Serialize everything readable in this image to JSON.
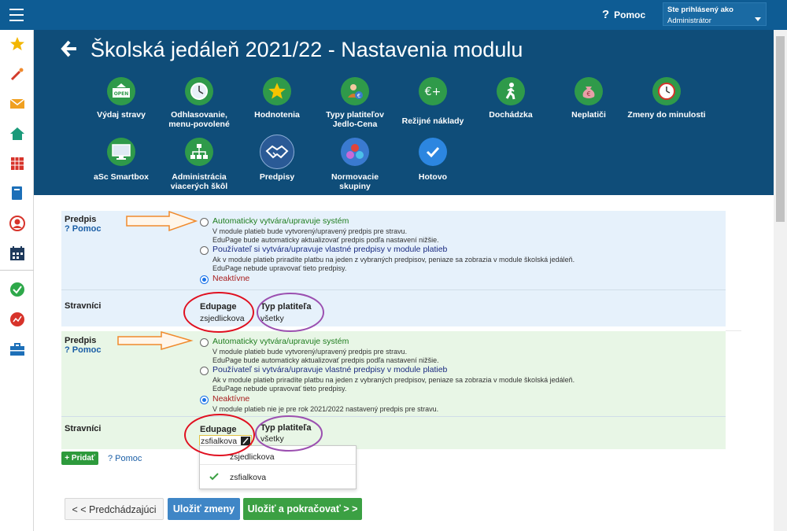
{
  "topbar": {
    "help_label": "Pomoc",
    "help_icon": "question-icon",
    "user_line1": "Ste prihlásený ako",
    "user_line2": "Administrátor"
  },
  "sidebar": {
    "items": [
      "star-icon",
      "magic-wand-icon",
      "envelope-icon",
      "home-icon",
      "timetable-icon",
      "book-icon",
      "user-icon",
      "calendar-icon",
      "check-circle-icon",
      "chart-icon",
      "briefcase-icon"
    ]
  },
  "header": {
    "title": "Školská jedáleň 2021/22 - Nastavenia modulu",
    "tiles_row1": [
      {
        "label": "Výdaj stravy",
        "icon": "open-sign-icon"
      },
      {
        "label": "Odhlasovanie, menu-povolené",
        "icon": "clock-icon"
      },
      {
        "label": "Hodnotenia",
        "icon": "star-icon"
      },
      {
        "label": "Typy platiteľov Jedlo-Cena",
        "icon": "payers-icon"
      },
      {
        "label": "Režijné náklady",
        "icon": "euro-plus-icon"
      },
      {
        "label": "Dochádzka",
        "icon": "walking-person-icon"
      },
      {
        "label": "Neplatiči",
        "icon": "money-bag-icon"
      },
      {
        "label": "Zmeny do minulosti",
        "icon": "history-clock-icon"
      }
    ],
    "tiles_row2": [
      {
        "label": "aSc Smartbox",
        "icon": "monitor-icon"
      },
      {
        "label": "Administrácia viacerých škôl",
        "icon": "hierarchy-icon"
      },
      {
        "label": "Predpisy",
        "icon": "handshake-icon"
      },
      {
        "label": "Normovacie skupiny",
        "icon": "group-circles-icon"
      },
      {
        "label": "Hotovo",
        "icon": "checkmark-icon"
      }
    ]
  },
  "section1": {
    "label": "Predpis",
    "help": "? Pomoc",
    "opt1_title": "Automaticky vytvára/upravuje systém",
    "opt1_d1": "V module platieb bude vytvorený/upravený predpis pre stravu.",
    "opt1_d2": "EduPage bude automaticky aktualizovať predpis podľa nastavení nižšie.",
    "opt2_title": "Používateľ si vytvára/upravuje vlastné predpisy v module platieb",
    "opt2_d1": "Ak v module platieb priradíte platbu na jeden z vybraných predpisov, peniaze sa zobrazia v module školská jedáleň.",
    "opt2_d2": "EduPage nebude upravovať tieto predpisy.",
    "opt3_title": "Neaktívne",
    "boarders_label": "Stravníci",
    "col_edupage": "Edupage",
    "val_edupage": "zsjedlickova",
    "col_payer": "Typ platiteľa",
    "val_payer": "všetky"
  },
  "section2": {
    "label": "Predpis",
    "help": "? Pomoc",
    "opt1_title": "Automaticky vytvára/upravuje systém",
    "opt1_d1": "V module platieb bude vytvorený/upravený predpis pre stravu.",
    "opt1_d2": "EduPage bude automaticky aktualizovať predpis podľa nastavení nižšie.",
    "opt2_title": "Používateľ si vytvára/upravuje vlastné predpisy v module platieb",
    "opt2_d1": "Ak v module platieb priradíte platbu na jeden z vybraných predpisov, peniaze sa zobrazia v module školská jedáleň.",
    "opt2_d2": "EduPage nebude upravovať tieto predpisy.",
    "opt3_title": "Neaktívne",
    "opt3_d1": "V module platieb nie je pre rok 2021/2022 nastavený predpis pre stravu.",
    "boarders_label": "Stravníci",
    "col_edupage": "Edupage",
    "val_edupage": "zsfialkova",
    "col_payer": "Typ platiteľa",
    "val_payer": "všetky"
  },
  "dropdown": {
    "items": [
      "zsjedlickova",
      "zsfialkova"
    ],
    "selected": "zsfialkova"
  },
  "actions": {
    "add_label": "+ Pridať",
    "help": "? Pomoc",
    "prev_label": "< < Predchádzajúci",
    "save_label": "Uložiť zmeny",
    "save_continue_label": "Uložiť a pokračovať > >"
  },
  "colors": {
    "topbar": "#0e5c94",
    "header": "#0f4d79",
    "annotation_arrow": "#f08a2c",
    "annotation_red": "#e01020",
    "annotation_purple": "#9b4fb0"
  }
}
